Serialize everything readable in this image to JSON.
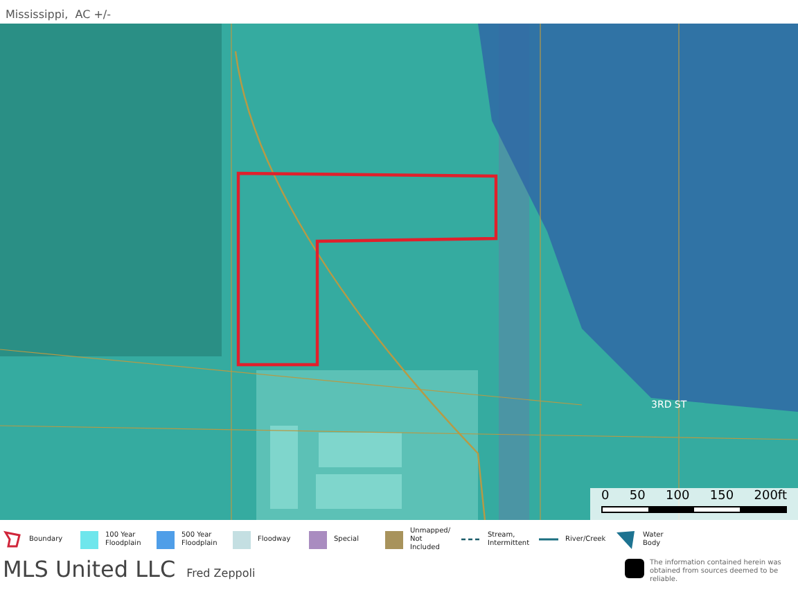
{
  "header": {
    "subtitle": "Mississippi,  AC +/-"
  },
  "map": {
    "street_label": "3RD ST",
    "scale": {
      "ticks": [
        "0",
        "50",
        "100",
        "150",
        "200ft"
      ]
    }
  },
  "legend": [
    {
      "kind": "boundary",
      "label": "Boundary",
      "color": "#d0253a"
    },
    {
      "kind": "swatch",
      "label": "100 Year Floodplain",
      "color": "#6ee6ec"
    },
    {
      "kind": "swatch",
      "label": "500 Year Floodplain",
      "color": "#4f9ee8"
    },
    {
      "kind": "swatch",
      "label": "Floodway",
      "color": "#c4dfe2"
    },
    {
      "kind": "swatch",
      "label": "Special",
      "color": "#a98cc0"
    },
    {
      "kind": "swatch",
      "label": "Unmapped/ Not Included",
      "color": "#a8935c"
    },
    {
      "kind": "dashed",
      "label": "Stream, Intermittent",
      "color": "#1b5c6a"
    },
    {
      "kind": "line",
      "label": "River/Creek",
      "color": "#1b6f80"
    },
    {
      "kind": "water",
      "label": "Water Body",
      "color": "#1d7391"
    }
  ],
  "footer": {
    "company": "MLS United LLC",
    "agent": "Fred Zeppoli",
    "disclaimer": "The information contained herein was obtained from sources deemed to be reliable."
  }
}
